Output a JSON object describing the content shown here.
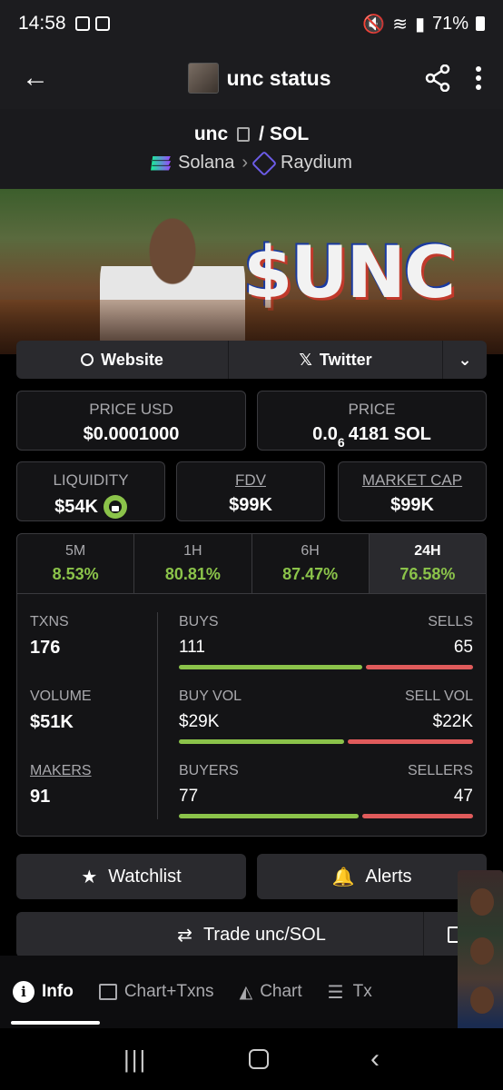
{
  "status_bar": {
    "time": "14:58",
    "battery": "71%"
  },
  "header": {
    "title": "unc status"
  },
  "pair": {
    "base": "unc",
    "separator": "/",
    "quote": "SOL",
    "chain": "Solana",
    "dex": "Raydium"
  },
  "banner": {
    "text": "$UNC"
  },
  "links": {
    "website": "Website",
    "twitter": "Twitter"
  },
  "price_usd": {
    "label": "PRICE USD",
    "value": "$0.0001000"
  },
  "price": {
    "label": "PRICE",
    "prefix": "0.0",
    "sub": "6",
    "suffix": "4181 SOL"
  },
  "liquidity": {
    "label": "LIQUIDITY",
    "value": "$54K"
  },
  "fdv": {
    "label": "FDV",
    "value": "$99K"
  },
  "market_cap": {
    "label": "MARKET CAP",
    "value": "$99K"
  },
  "timeframes": [
    {
      "label": "5M",
      "value": "8.53%"
    },
    {
      "label": "1H",
      "value": "80.81%"
    },
    {
      "label": "6H",
      "value": "87.47%"
    },
    {
      "label": "24H",
      "value": "76.58%"
    }
  ],
  "txns": {
    "label": "TXNS",
    "value": "176"
  },
  "volume": {
    "label": "VOLUME",
    "value": "$51K"
  },
  "makers": {
    "label": "MAKERS",
    "value": "91"
  },
  "buys": {
    "label": "BUYS",
    "value": "111",
    "sell_label": "SELLS",
    "sell_value": "65",
    "buy_ratio": 0.63
  },
  "buy_vol": {
    "label": "BUY VOL",
    "value": "$29K",
    "sell_label": "SELL VOL",
    "sell_value": "$22K",
    "buy_ratio": 0.57
  },
  "buyers": {
    "label": "BUYERS",
    "value": "77",
    "sell_label": "SELLERS",
    "sell_value": "47",
    "buy_ratio": 0.62
  },
  "buttons": {
    "watchlist": "Watchlist",
    "alerts": "Alerts",
    "trade": "Trade unc/SOL"
  },
  "nav": {
    "info": "Info",
    "chart_txns": "Chart+Txns",
    "chart": "Chart",
    "txns": "Tx"
  },
  "colors": {
    "green": "#8bc34a",
    "red": "#e05b5b",
    "background": "#000000",
    "panel": "#141416"
  }
}
